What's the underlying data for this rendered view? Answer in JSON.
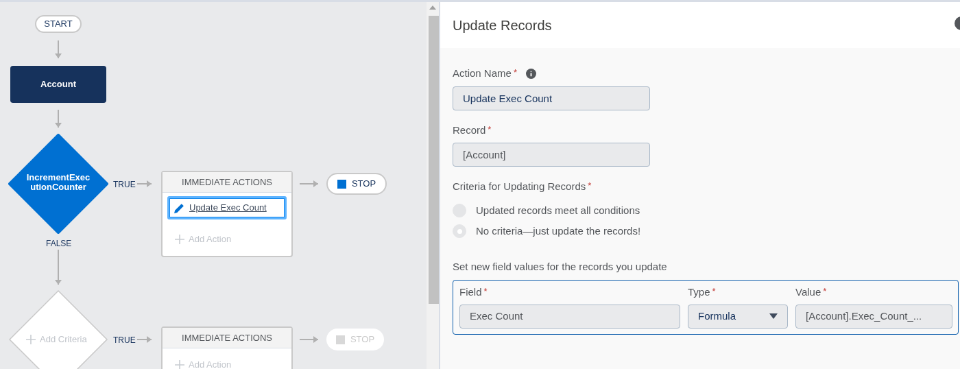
{
  "flow": {
    "start_label": "START",
    "object_node": "Account",
    "criteria_nodes": [
      {
        "kind": "defined",
        "label": "IncrementExecutionCounter",
        "true_label": "TRUE",
        "false_label": "FALSE",
        "actions_header": "IMMEDIATE ACTIONS",
        "actions": [
          {
            "label": "Update Exec Count",
            "selected": true
          }
        ],
        "add_action": "Add Action",
        "stop": "STOP",
        "stop_enabled": true
      },
      {
        "kind": "empty",
        "label": "Add Criteria",
        "true_label": "TRUE",
        "actions_header": "IMMEDIATE ACTIONS",
        "add_action": "Add Action",
        "stop": "STOP",
        "stop_enabled": false
      }
    ]
  },
  "panel": {
    "title": "Update Records",
    "fields": [
      {
        "label": "Action Name",
        "required_mark": "*",
        "info": true,
        "value": "Update Exec Count",
        "disabled": false
      },
      {
        "label": "Record",
        "required_mark": "*",
        "info": false,
        "value": "[Account]",
        "disabled": true
      }
    ],
    "criteria": {
      "label": "Criteria for Updating Records",
      "required_mark": "*",
      "options": [
        {
          "label": "Updated records meet all conditions",
          "selected": false
        },
        {
          "label": "No criteria—just update the records!",
          "selected": true
        }
      ]
    },
    "field_values": {
      "label": "Set new field values for the records you update",
      "columns": [
        {
          "label": "Field",
          "required_mark": "*"
        },
        {
          "label": "Type",
          "required_mark": "*"
        },
        {
          "label": "Value",
          "required_mark": "*"
        }
      ],
      "rows": [
        {
          "field": "Exec Count",
          "type": "Formula",
          "value": "[Account].Exec_Count_..."
        }
      ]
    }
  }
}
